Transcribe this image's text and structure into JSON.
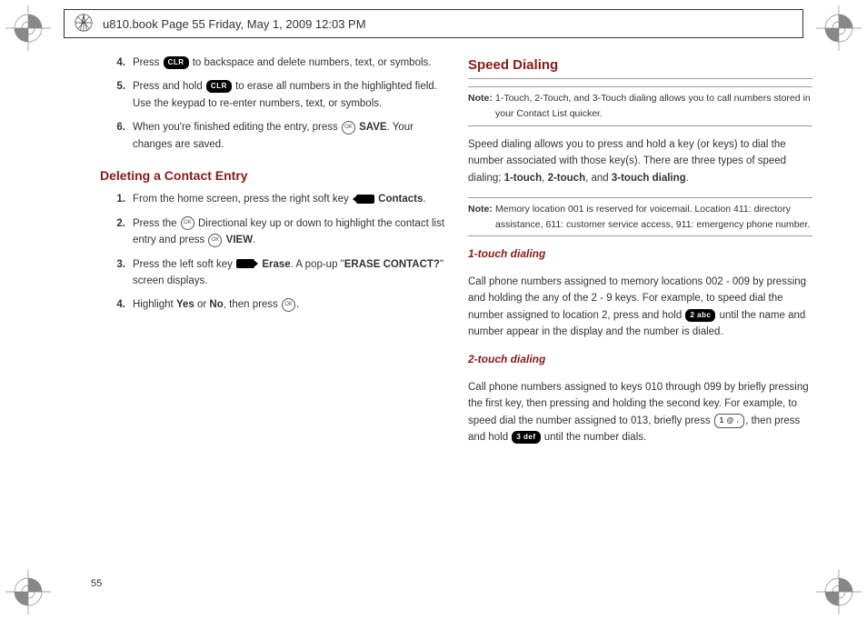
{
  "header": "u810.book  Page 55  Friday, May 1, 2009  12:03 PM",
  "page_num": "55",
  "left": {
    "s4a": "Press ",
    "s4c": " to backspace and delete numbers, text, or symbols.",
    "s5a": "Press and hold ",
    "s5c": " to erase all numbers in the highlighted field. Use the keypad to re-enter numbers, text, or symbols.",
    "s6a": "When you're finished editing the entry, press ",
    "s6b": " SAVE",
    "s6c": ". Your changes are saved.",
    "h_del": "Deleting a Contact Entry",
    "d1a": "From the home screen, press the right soft key ",
    "d1c": " Contacts",
    "d1d": ".",
    "d2a": "Press the ",
    "d2c": " Directional key up or down to highlight the contact list entry and press ",
    "d2d": " VIEW",
    "d2e": ".",
    "d3a": "Press the left soft key ",
    "d3c": " Erase",
    "d3d": ". A pop-up \"",
    "d3e": "ERASE CONTACT?",
    "d3f": "\" screen displays.",
    "d4a": "Highlight ",
    "d4b": "Yes",
    "d4c": " or ",
    "d4d": "No",
    "d4e": ", then press ",
    "d4g": "."
  },
  "right": {
    "h_speed": "Speed Dialing",
    "note1_label": "Note:",
    "note1": "1-Touch, 2-Touch, and 3-Touch dialing allows you to call numbers stored in your Contact List quicker.",
    "p1a": "Speed dialing allows you to press and hold a key (or keys) to dial the number associated with those key(s). There are three types of speed dialing; ",
    "p1b": "1-touch",
    "p1c": ", ",
    "p1d": "2-touch",
    "p1e": ", and ",
    "p1f": "3-touch dialing",
    "p1g": ".",
    "note2_label": "Note:",
    "note2": "Memory location 001 is reserved for voicemail. Location 411: directory assistance, 611: customer service access, 911: emergency phone number.",
    "h_1t": "1-touch dialing",
    "t1a": "Call phone numbers assigned to memory locations 002 - 009 by pressing and holding the any of the 2 - 9 keys. For example, to speed dial the number assigned to location 2, press and hold ",
    "t1c": " until the name and number appear in the display and the number is dialed.",
    "h_2t": "2-touch dialing",
    "t2a": "Call phone numbers assigned to keys 010 through 099 by briefly pressing the first key, then pressing and holding the second key. For example, to speed dial the number assigned to 013, briefly press ",
    "t2c": ", then press and hold ",
    "t2e": " until the number dials."
  },
  "keys": {
    "clr": "CLR",
    "ok": "OK",
    "abc2": "2 abc",
    "one": "1 @ .",
    "def3": "3 def"
  },
  "nums": {
    "n4": "4.",
    "n5": "5.",
    "n6": "6.",
    "n1": "1.",
    "n2": "2.",
    "n3": "3."
  }
}
